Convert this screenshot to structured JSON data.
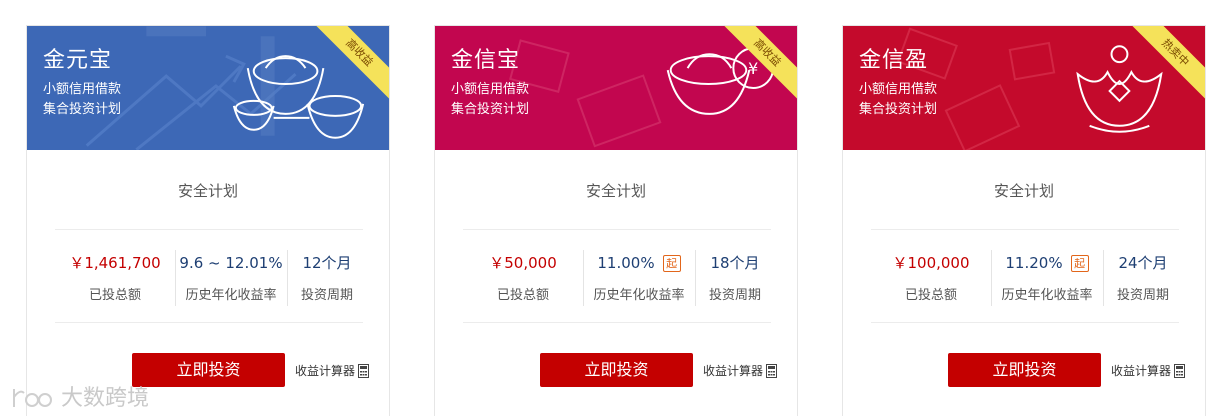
{
  "cards": [
    {
      "name": "金元宝",
      "sub1": "小额信用借款",
      "sub2": "集合投资计划",
      "ribbon": "高收益",
      "plan_title": "安全计划",
      "amount": "￥1,461,700",
      "amount_label": "已投总额",
      "rate": "9.6 ~ 12.01%",
      "rate_label": "历史年化收益率",
      "period": "12个月",
      "period_label": "投资周期",
      "button": "立即投资",
      "calc": "收益计算器",
      "banner_color": "#3d68b6"
    },
    {
      "name": "金信宝",
      "sub1": "小额信用借款",
      "sub2": "集合投资计划",
      "ribbon": "高收益",
      "plan_title": "安全计划",
      "amount": "￥50,000",
      "amount_label": "已投总额",
      "rate": "11.00%",
      "rate_badge": "起",
      "rate_label": "历史年化收益率",
      "period": "18个月",
      "period_label": "投资周期",
      "button": "立即投资",
      "calc": "收益计算器",
      "banner_color": "#c2064f"
    },
    {
      "name": "金信盈",
      "sub1": "小额信用借款",
      "sub2": "集合投资计划",
      "ribbon": "热卖中",
      "plan_title": "安全计划",
      "amount": "￥100,000",
      "amount_label": "已投总额",
      "rate": "11.20%",
      "rate_badge": "起",
      "rate_label": "历史年化收益率",
      "period": "24个月",
      "period_label": "投资周期",
      "button": "立即投资",
      "calc": "收益计算器",
      "banner_color": "#c40a2c"
    }
  ],
  "watermark": "大数跨境",
  "colors": {
    "ribbon": "#f5e25a",
    "button": "#c40000",
    "amount": "#c40000",
    "rate": "#1e3f73",
    "badge": "#e2661b"
  }
}
